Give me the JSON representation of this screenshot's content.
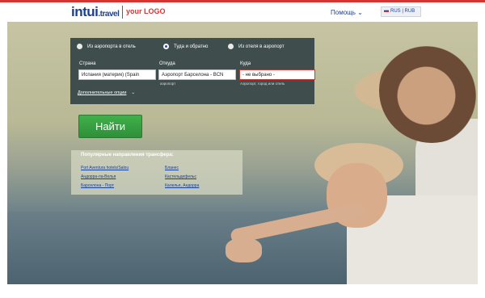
{
  "header": {
    "logo_main": "intui",
    "logo_suffix": ".travel",
    "partner_logo": "your LOGO",
    "help": "Помощь ⌄",
    "lang": "RUS | RUB"
  },
  "search": {
    "trip_types": [
      {
        "label": "Из аэропорта в отель",
        "selected": false
      },
      {
        "label": "Туда и обратно",
        "selected": true
      },
      {
        "label": "Из отеля в аэропорт",
        "selected": false
      }
    ],
    "country": {
      "label": "Страна",
      "value": "Испания (материк) (Spain"
    },
    "from": {
      "label": "Откуда",
      "value": "Аэропорт Барселона - BCN",
      "hint": "аэропорт"
    },
    "to": {
      "label": "Куда",
      "value": "- не выбрано -",
      "hint": "Аэропорт, город или отель"
    },
    "more_options": "Дополнительные опции",
    "more_chevron": "⌄",
    "submit": "Найти"
  },
  "popular": {
    "title": "Популярные направления трансфера:",
    "left": [
      "Port Aventura hotels/Salou",
      "Андорра-ла-Велья",
      "Барселона - Порт"
    ],
    "right": [
      "Бланес",
      "Кастельдефельс",
      "Калелья, Андорра"
    ]
  },
  "colors": {
    "accent": "#d9322f",
    "brand": "#1b3f8f",
    "submit": "#3aa444"
  }
}
